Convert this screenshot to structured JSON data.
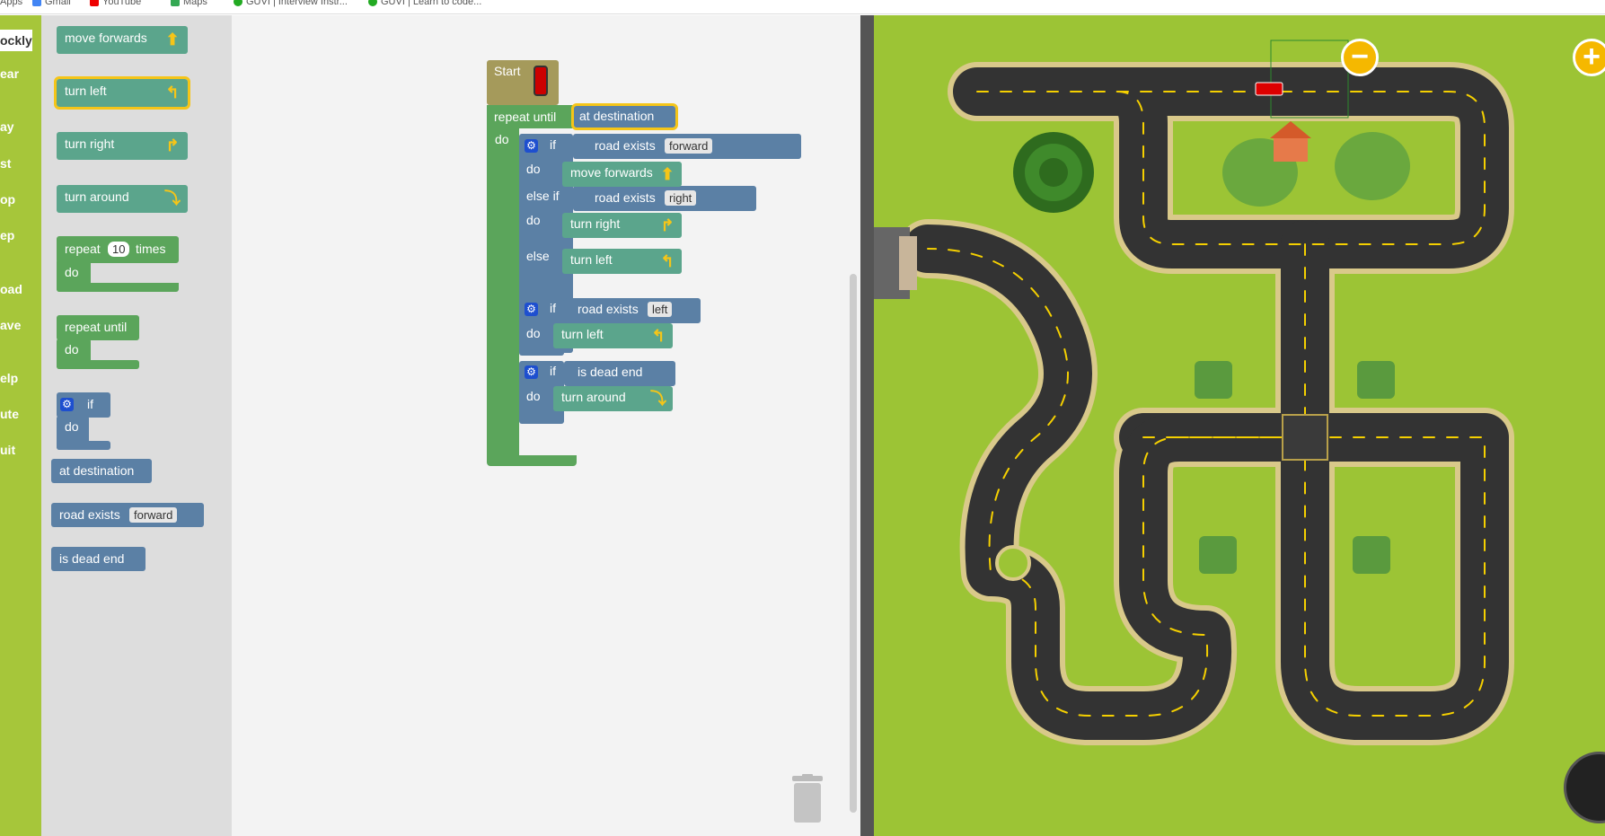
{
  "bookmarks": [
    "Apps",
    "Gmail",
    "YouTube",
    "Maps",
    "GUVI | Interview Instr...",
    "GUVI | Learn to code..."
  ],
  "nav": {
    "items": [
      "ockly",
      "ear",
      "ay",
      "st",
      "op",
      "ep",
      "oad",
      "ave",
      "elp",
      "ute",
      "uit"
    ]
  },
  "toolbox": {
    "move_forwards": "move forwards",
    "turn_left": "turn left",
    "turn_right": "turn right",
    "turn_around": "turn around",
    "repeat": "repeat",
    "repeat_count": "10",
    "times": "times",
    "do": "do",
    "repeat_until": "repeat until",
    "if": "if",
    "at_destination": "at destination",
    "road_exists": "road exists",
    "forward": "forward",
    "is_dead_end": "is dead end"
  },
  "program": {
    "start": "Start",
    "repeat_until": "repeat until",
    "at_destination": "at destination",
    "do": "do",
    "if": "if",
    "else_if": "else if",
    "else": "else",
    "road_exists": "road exists",
    "forward": "forward",
    "right": "right",
    "left": "left",
    "move_forwards": "move forwards",
    "turn_right": "turn right",
    "turn_left": "turn left",
    "is_dead_end": "is dead end",
    "turn_around": "turn around"
  },
  "map": {
    "zoom_out": "−",
    "zoom_in": "+"
  },
  "colors": {
    "grass": "#9cc435",
    "road": "#333333",
    "accent": "#f5b800"
  }
}
